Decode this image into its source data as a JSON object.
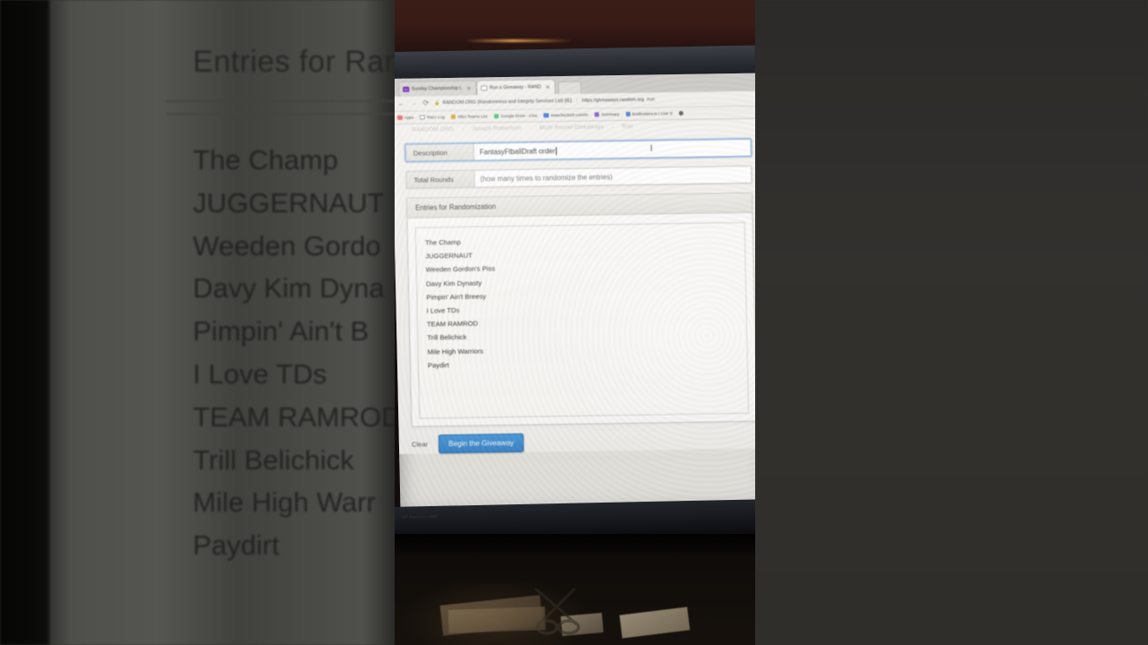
{
  "browser": {
    "tabs": [
      {
        "title": "Sunday Championship L",
        "favicon": "yahoo-icon",
        "active": false
      },
      {
        "title": "Run a Giveaway - RAND",
        "favicon": "random-org-icon",
        "active": true
      }
    ],
    "nav": {
      "back_icon": "back-arrow-icon",
      "forward_icon": "forward-arrow-icon",
      "reload_icon": "reload-icon"
    },
    "address_bar": {
      "lock_icon": "lock-icon",
      "site_name": "RANDOM.ORG (Randomness and Integrity Services Ltd) [IE]",
      "url": "https://giveaways.random.org/run",
      "url_domain": "https://giveaways.random.org",
      "url_path": "/run"
    },
    "bookmarks": [
      {
        "label": "Apps",
        "icon": "apps-grid-icon"
      },
      {
        "label": "Razz Log",
        "icon": "page-icon"
      },
      {
        "label": "NBA Teams List",
        "icon": "nba-icon"
      },
      {
        "label": "Google Drive - Clou",
        "icon": "google-drive-icon"
      },
      {
        "label": "www.beckett.com/m",
        "icon": "beckett-icon"
      },
      {
        "label": "Summary",
        "icon": "summary-icon"
      },
      {
        "label": "boxbusters.tv | Live S",
        "icon": "boxbusters-icon"
      }
    ]
  },
  "page": {
    "breadcrumb": {
      "root": "RANDOM.ORG",
      "user": "Joseph Robertson",
      "section": "Multi-Round Giveaways",
      "current": "Run"
    },
    "description_field": {
      "label": "Description",
      "value": "Fantasy Ftball Draft order",
      "value_prefix": "Fantasy ",
      "value_misspelled": "Ftball",
      "value_suffix": " Draft order",
      "focused": true,
      "cursor_icon": "text-ibeam-cursor"
    },
    "total_rounds_field": {
      "label": "Total Rounds",
      "value": "",
      "hint": "(how many times to randomize the entries)"
    },
    "entries_panel": {
      "title": "Entries for Randomization",
      "entries": [
        {
          "text": "The Champ",
          "misspelled": []
        },
        {
          "text": "JUGGERNAUT",
          "misspelled": []
        },
        {
          "text": "Weeden Gordon's Piss",
          "misspelled": [
            "Weeden"
          ]
        },
        {
          "text": "Davy Kim Dynasty",
          "misspelled": []
        },
        {
          "text": "Pimpin' Ain't Breesy",
          "misspelled": [
            "Pimpin'",
            "Breesy"
          ]
        },
        {
          "text": "I Love TDs",
          "misspelled": [
            "TDs"
          ]
        },
        {
          "text": "TEAM RAMROD",
          "misspelled": []
        },
        {
          "text": "Trill Belichick",
          "misspelled": [
            "Belichick"
          ]
        },
        {
          "text": "Mile High Warriors",
          "misspelled": []
        },
        {
          "text": "Paydirt",
          "misspelled": [
            "Paydirt"
          ]
        }
      ]
    },
    "actions": {
      "clear_label": "Clear",
      "begin_label": "Begin the Giveaway"
    }
  },
  "background_overlay": {
    "heading": "Entries for Ran",
    "lines": [
      "The Champ",
      "JUGGERNAUT",
      "Weeden Gordo",
      "Davy Kim Dyna",
      "Pimpin' Ain't B",
      "I Love TDs",
      "TEAM RAMROD",
      "Trill Belichick",
      "Mile High Warr",
      "Paydirt"
    ]
  },
  "photo": {
    "deck_label": "HP Pavilion x360",
    "desk_items": [
      "papers",
      "scissors",
      "handwritten-card"
    ]
  },
  "colors": {
    "accent_blue": "#3d87cc",
    "spellcheck_red": "#b8453a",
    "screen_bg": "#f4f2ee",
    "chrome_bg": "#f1efeb",
    "wall": "#3b1d18",
    "backdrop": "#2f2f2b"
  }
}
